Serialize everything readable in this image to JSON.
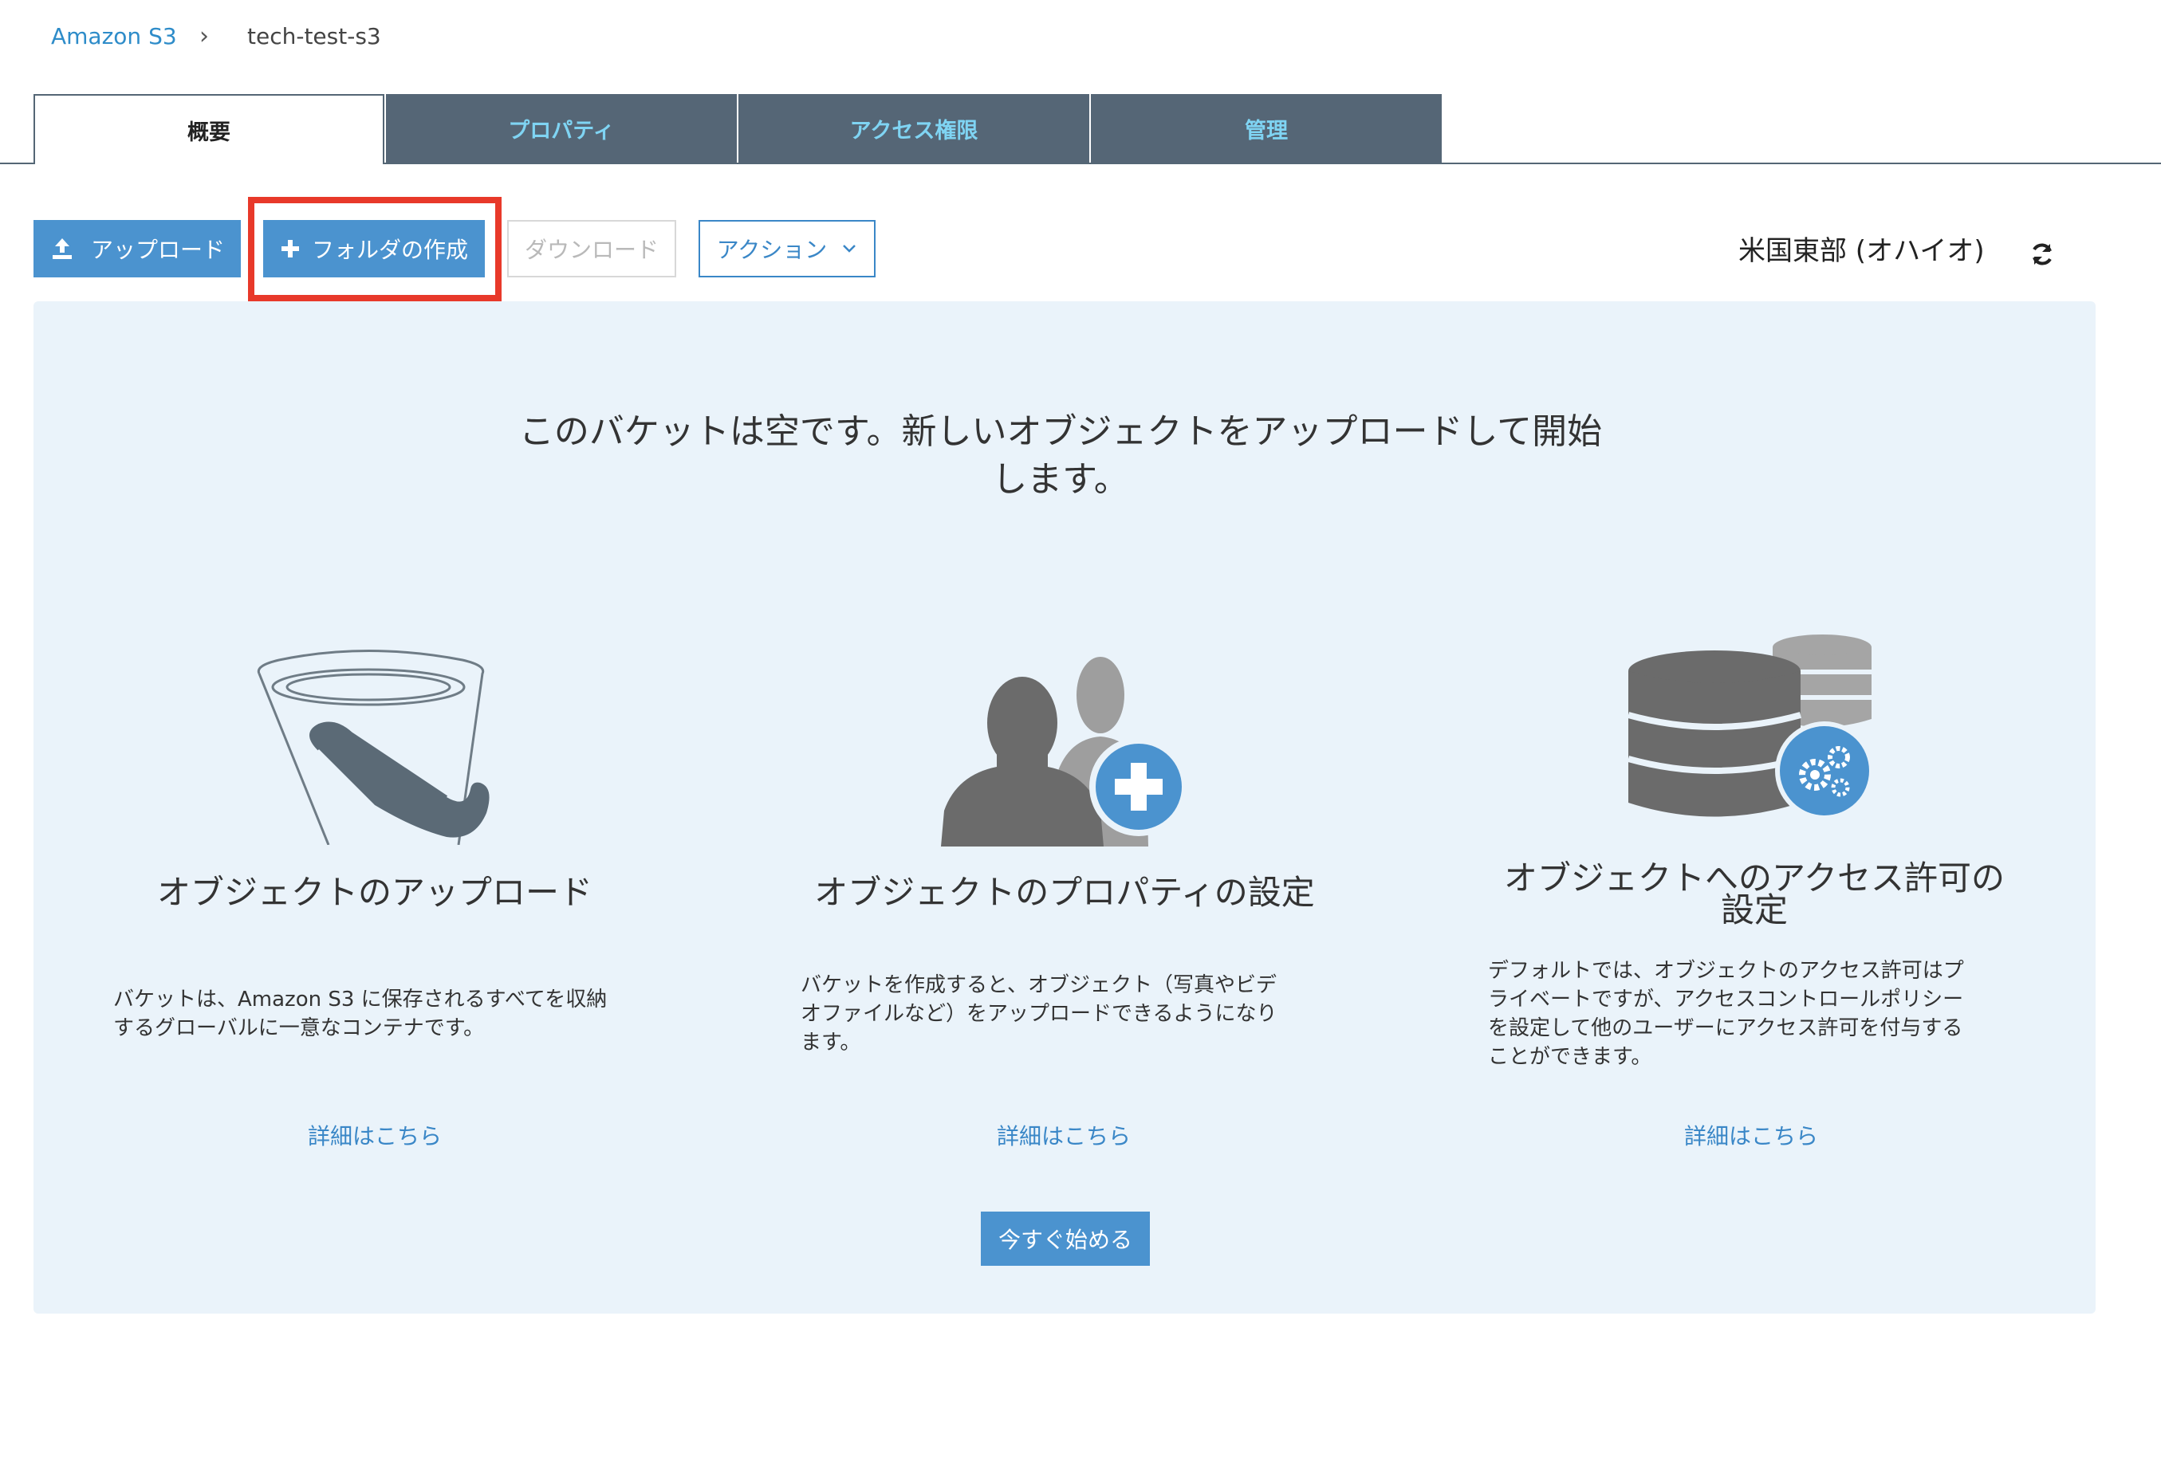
{
  "breadcrumb": {
    "root": "Amazon S3",
    "separator": "›",
    "current": "tech-test-s3"
  },
  "tabs": [
    {
      "label": "概要",
      "active": true
    },
    {
      "label": "プロパティ",
      "active": false
    },
    {
      "label": "アクセス権限",
      "active": false
    },
    {
      "label": "管理",
      "active": false
    }
  ],
  "toolbar": {
    "upload_label": "アップロード",
    "create_folder_label": "フォルダの作成",
    "download_label": "ダウンロード",
    "actions_label": "アクション",
    "region_label": "米国東部 (オハイオ)"
  },
  "empty_state": {
    "headline_line1": "このバケットは空です。新しいオブジェクトをアップロードして開始",
    "headline_line2": "します。",
    "columns": [
      {
        "title": "オブジェクトのアップロード",
        "desc_lines": [
          "バケットは、Amazon S3 に保存されるすべてを収納",
          "するグローバルに一意なコンテナです。"
        ],
        "link": "詳細はこちら"
      },
      {
        "title": "オブジェクトのプロパティの設定",
        "desc_lines": [
          "バケットを作成すると、オブジェクト（写真やビデ",
          "オファイルなど）をアップロードできるようになり",
          "ます。"
        ],
        "link": "詳細はこちら"
      },
      {
        "title_line1": "オブジェクトへのアクセス許可の",
        "title_line2": "設定",
        "desc_lines": [
          "デフォルトでは、オブジェクトのアクセス許可はプ",
          "ライベートですが、アクセスコントロールポリシー",
          "を設定して他のユーザーにアクセス許可を付与する",
          "ことができます。"
        ],
        "link": "詳細はこちら"
      }
    ],
    "start_button": "今すぐ始める"
  },
  "colors": {
    "primary_button": "#4b93cf",
    "tab_dark": "#556676",
    "tab_text": "#7fd4f3",
    "panel_bg": "#eaf3fa",
    "highlight": "#e8392a",
    "icon_gray": "#6b6b6b",
    "icon_blue": "#4b93cf"
  },
  "icons": [
    "upload-icon",
    "plus-icon",
    "chevron-down-icon",
    "refresh-icon",
    "bucket-icon",
    "users-add-icon",
    "database-settings-icon"
  ]
}
